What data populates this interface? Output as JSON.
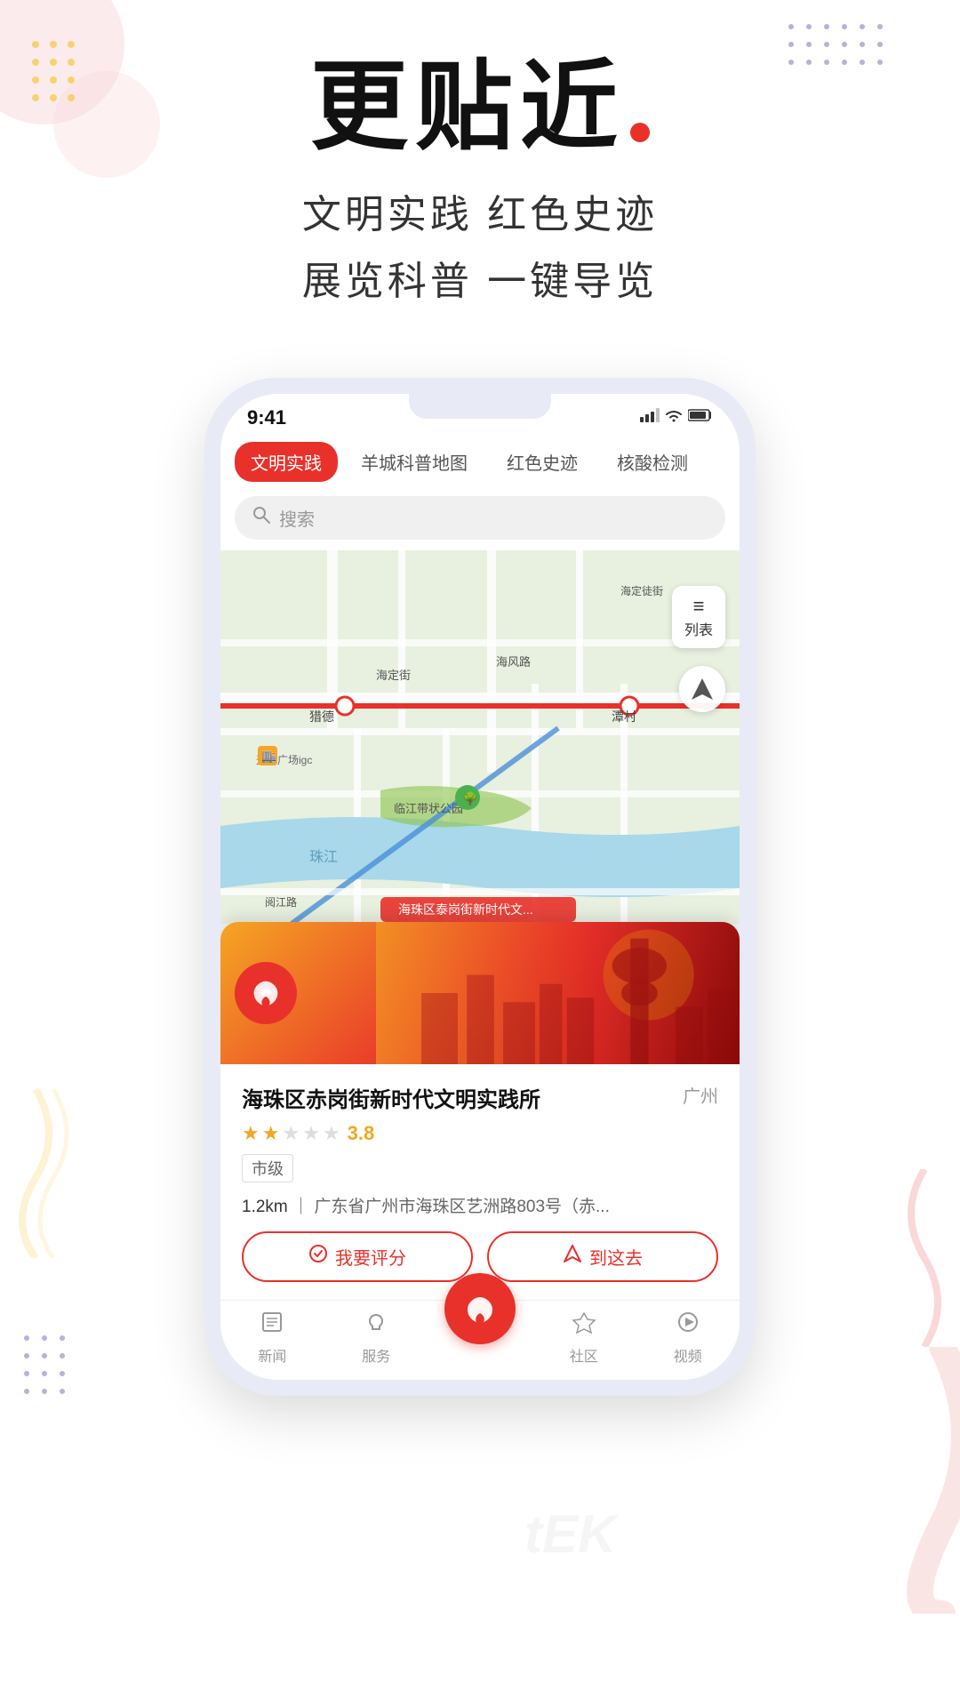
{
  "page": {
    "background_color": "#ffffff"
  },
  "hero": {
    "main_title": "更贴近",
    "title_dot": "●",
    "subtitle_line1": "文明实践 红色史迹",
    "subtitle_line2": "展览科普 一键导览"
  },
  "phone": {
    "status_bar": {
      "time": "9:41",
      "signal": "📶",
      "wifi": "WiFi",
      "battery": "🔋"
    },
    "tabs": [
      {
        "label": "文明实践",
        "active": true
      },
      {
        "label": "羊城科普地图",
        "active": false
      },
      {
        "label": "红色史迹",
        "active": false
      },
      {
        "label": "核酸检测",
        "active": false
      }
    ],
    "search": {
      "placeholder": "搜索"
    },
    "map": {
      "poi_banner": "海珠区泰岗街新时代文...",
      "list_btn": "列表",
      "locations": [
        {
          "name": "猎德",
          "type": "metro"
        },
        {
          "name": "潭村",
          "type": "metro"
        },
        {
          "name": "天汇广场igc",
          "type": "mall"
        },
        {
          "name": "海定街",
          "type": "area"
        },
        {
          "name": "海风路",
          "type": "road"
        },
        {
          "name": "临江带状公园",
          "type": "park"
        },
        {
          "name": "珠江",
          "type": "river"
        },
        {
          "name": "阅江路",
          "type": "road"
        }
      ]
    },
    "detail_card": {
      "title": "海珠区赤岗街新时代文明实践所",
      "city": "广州",
      "rating": "3.8",
      "stars": [
        true,
        true,
        false,
        false,
        false
      ],
      "level": "市级",
      "distance": "1.2km",
      "address": "广东省广州市海珠区艺洲路803号（赤...",
      "btn_rate": "我要评分",
      "btn_navigate": "到这去"
    },
    "bottom_nav": [
      {
        "icon": "📰",
        "label": "新闻"
      },
      {
        "icon": "♡",
        "label": "服务"
      },
      {
        "icon": "center",
        "label": ""
      },
      {
        "icon": "⌂",
        "label": "社区"
      },
      {
        "icon": "▶",
        "label": "视频"
      }
    ]
  },
  "decorations": {
    "dots_color_purple": "#6b6bb5",
    "dots_color_yellow": "#f5c842",
    "pink_circle_color": "#fadadd",
    "accent_red": "#e8312a",
    "wave_color_pink": "#f5c0c0",
    "wave_color_yellow": "#f5e0a0"
  }
}
